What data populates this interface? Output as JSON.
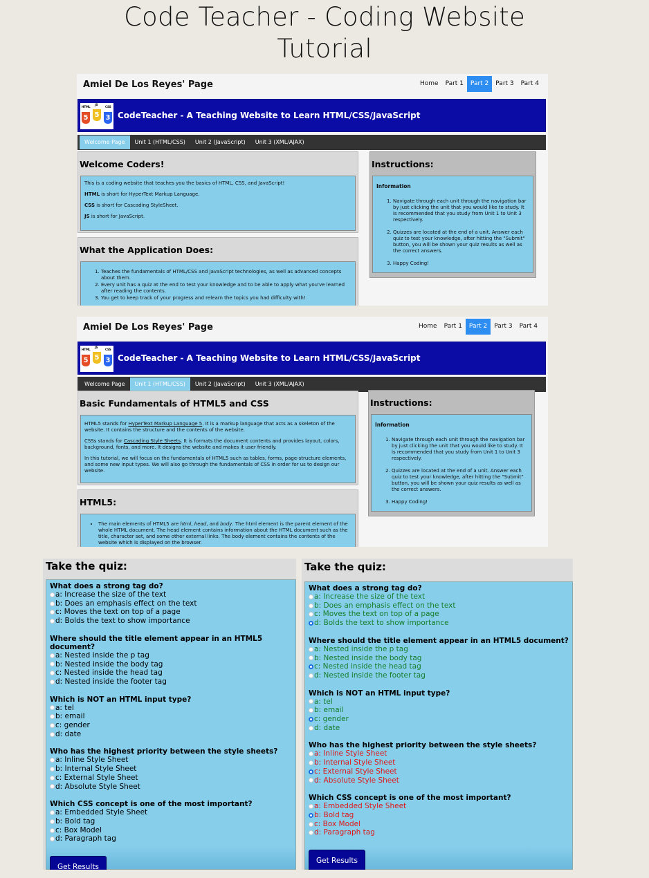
{
  "title_line1": "Code Teacher - Coding Website",
  "title_line2": "Tutorial",
  "site": {
    "owner": "Amiel De Los Reyes' Page",
    "parts": [
      "Home",
      "Part 1",
      "Part 2",
      "Part 3",
      "Part 4"
    ],
    "active_part": "Part 2",
    "banner_title": "CodeTeacher - A Teaching Website to Learn HTML/CSS/JavaScript",
    "logo_labels": [
      "HTML",
      "JS",
      "CSS"
    ],
    "logo_numbers": [
      "5",
      "5",
      "3"
    ],
    "units": [
      "Welcome Page",
      "Unit 1 (HTML/CSS)",
      "Unit 2 (JavaScript)",
      "Unit 3 (XML/AJAX)"
    ]
  },
  "instructions": {
    "heading": "Instructions:",
    "info_title": "Information",
    "items": [
      "Navigate through each unit through the navigation bar by just clicking the unit that you would like to study. It is recommended that you study from Unit 1 to Unit 3 respectively.",
      "Quizzes are located at the end of a unit. Answer each quiz to test your knowledge, after hitting the \"Submit\" button, you will be shown your quiz results as well as the correct answers.",
      "Happy Coding!"
    ]
  },
  "welcome": {
    "heading": "Welcome Coders!",
    "intro": "This is a coding website that teaches you the basics of HTML, CSS, and JavaScript!",
    "defs": [
      {
        "term": "HTML",
        "text": " is short for HyperText Markup Language."
      },
      {
        "term": "CSS",
        "text": " is short for Cascading StyleSheet."
      },
      {
        "term": "JS",
        "text": " is short for JavaScript."
      }
    ],
    "app_heading": "What the Application Does:",
    "app_items": [
      "Teaches the fundamentals of HTML/CSS and JavaScript technologies, as well as advanced concepts about them.",
      "Every unit has a quiz at the end to test your knowledge and to be able to apply what you've learned after reading the contents.",
      "You get to keep track of your progress and relearn the topics you had difficulty with!"
    ]
  },
  "unit1": {
    "heading": "Basic Fundamentals of HTML5 and CSS",
    "p1_pre": "HTML5 stands for ",
    "p1_link": "HyperText Markup Language 5",
    "p1_post": ". It is a markup language that acts as a skeleton of the website. It contains the structure and the contents of the website.",
    "p2_pre": "CSSs stands for ",
    "p2_link": "Cascading Style Sheets",
    "p2_post": ". It is formats the document contents and provides layout, colors, background, fonts, and more. It designs the website and makes it user friendly.",
    "p3": "In this tutorial, we will focus on the fundamentals of HTML5 such as tables, forms, page-structure elements, and some new input types. We will also go through the fundamentals of CSS in order for us to design our website.",
    "html5_heading": "HTML5:",
    "bullet_pre": "The main elements of HTML5 are ",
    "bullet_em1": "html",
    "bullet_sep1": ", ",
    "bullet_em2": "head",
    "bullet_sep2": ", and ",
    "bullet_em3": "body",
    "bullet_post": ". The html element is the parent element of the whole HTML document. The head element contains information about the HTML document such as the title, character set, and some other external links. The body element contains the contents of the website which is displayed on the browser."
  },
  "quiz": {
    "heading": "Take the quiz:",
    "button": "Get Results",
    "questions": [
      {
        "q": "What does a strong tag do?",
        "options": [
          "a: Increase the size of the text",
          "b: Does an emphasis effect on the text",
          "c: Moves the text on top of a page",
          "d: Bolds the text to show importance"
        ]
      },
      {
        "q": "Where should the title element appear in an HTML5 document?",
        "options": [
          "a: Nested inside the p tag",
          "b: Nested inside the body tag",
          "c: Nested inside the head tag",
          "d: Nested inside the footer tag"
        ]
      },
      {
        "q": "Which is NOT an HTML input type?",
        "options": [
          "a: tel",
          "b: email",
          "c: gender",
          "d: date"
        ]
      },
      {
        "q": "Who has the highest priority between the style sheets?",
        "options": [
          "a: Inline Style Sheet",
          "b: Internal Style Sheet",
          "c: External Style Sheet",
          "d: Absolute Style Sheet"
        ]
      },
      {
        "q": "Which CSS concept is one of the most important?",
        "options": [
          "a: Embedded Style Sheet",
          "b: Bold tag",
          "c: Box Model",
          "d: Paragraph tag"
        ]
      }
    ],
    "result_selected": [
      3,
      2,
      2,
      2,
      1
    ],
    "result_status": [
      "correct",
      "correct",
      "correct",
      "wrong",
      "wrong"
    ]
  },
  "colors": {
    "background": "#ece9e2",
    "banner": "#0b0ba6",
    "active_nav": "#2e8df0",
    "panel_blue": "#87ceeb",
    "correct": "#167f2b",
    "wrong": "#e01818",
    "button": "#050596"
  }
}
